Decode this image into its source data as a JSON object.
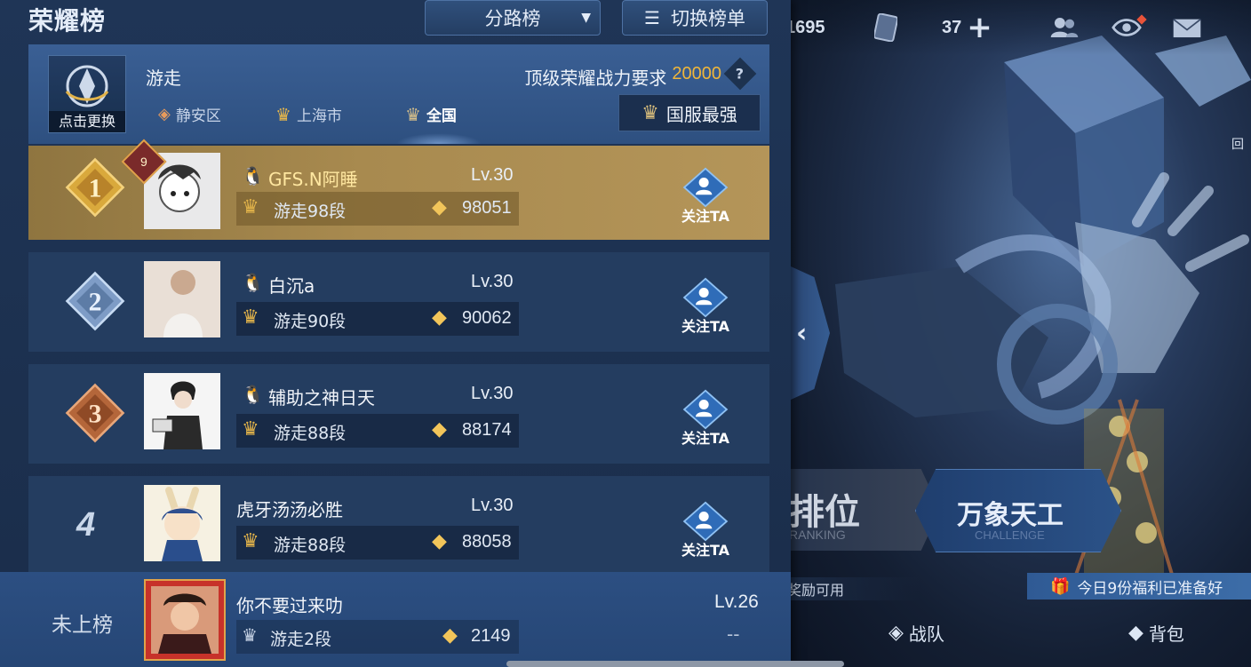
{
  "panel": {
    "title": "荣耀榜",
    "route_dropdown": "分路榜",
    "switch_list": "切换榜单"
  },
  "header": {
    "role": "游走",
    "change_label": "点击更换",
    "requirement_label": "顶级荣耀战力要求",
    "requirement_value": "20000",
    "region_tabs": [
      "静安区",
      "上海市",
      "全国"
    ],
    "best_button": "国服最强"
  },
  "rows": [
    {
      "rank": "1",
      "badge": "9",
      "name": "GFS.N阿睡",
      "level": "Lv.30",
      "tier": "游走98段",
      "score": "98051",
      "follow": "关注TA"
    },
    {
      "rank": "2",
      "name": "白沉a",
      "level": "Lv.30",
      "tier": "游走90段",
      "score": "90062",
      "follow": "关注TA"
    },
    {
      "rank": "3",
      "name": "辅助之神日天",
      "level": "Lv.30",
      "tier": "游走88段",
      "score": "88174",
      "follow": "关注TA"
    },
    {
      "rank": "4",
      "name": "虎牙汤汤必胜",
      "level": "Lv.30",
      "tier": "游走88段",
      "score": "88058",
      "follow": "关注TA"
    }
  ],
  "self": {
    "status": "未上榜",
    "name": "你不要过来叻",
    "level": "Lv.26",
    "tier": "游走2段",
    "score": "2149",
    "rank_placeholder": "--"
  },
  "topbar": {
    "coins": "1695",
    "count": "37"
  },
  "scene": {
    "rank_mode": "排位",
    "rank_sub": "RANKING",
    "challenge_mode": "万象天工",
    "challenge_sub": "CHALLENGE",
    "reward_hint": "奖励可用",
    "welfare": "今日9份福利已准备好",
    "team": "战队",
    "bag": "背包",
    "back": "回"
  },
  "colors": {
    "gold": "#f0b63a",
    "panel": "#1f3556"
  }
}
